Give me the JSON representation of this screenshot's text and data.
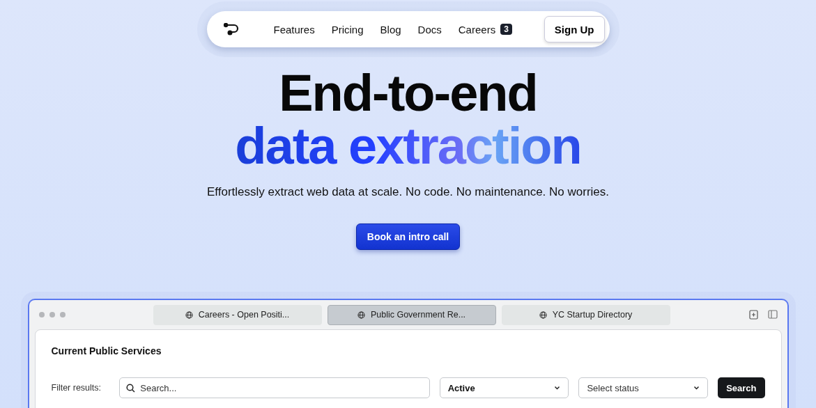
{
  "nav": {
    "links": [
      {
        "label": "Features"
      },
      {
        "label": "Pricing"
      },
      {
        "label": "Blog"
      },
      {
        "label": "Docs"
      },
      {
        "label": "Careers",
        "badge": "3"
      }
    ],
    "cta": "Sign Up"
  },
  "hero": {
    "title": "End-to-end",
    "title_accent": "data extraction",
    "subtitle": "Effortlessly extract web data at scale. No code. No maintenance. No worries.",
    "button": "Book an intro call"
  },
  "browser": {
    "tabs": [
      {
        "label": "Careers - Open Positi...",
        "selected": false
      },
      {
        "label": "Public Government Re...",
        "selected": true
      },
      {
        "label": "YC Startup Directory",
        "selected": false
      }
    ],
    "panel": {
      "title": "Current Public Services",
      "filter_label": "Filter results:",
      "search": {
        "placeholder": "Search..."
      },
      "type_select": {
        "value": "Active"
      },
      "status_select": {
        "placeholder": "Select status"
      },
      "button": "Search"
    }
  }
}
